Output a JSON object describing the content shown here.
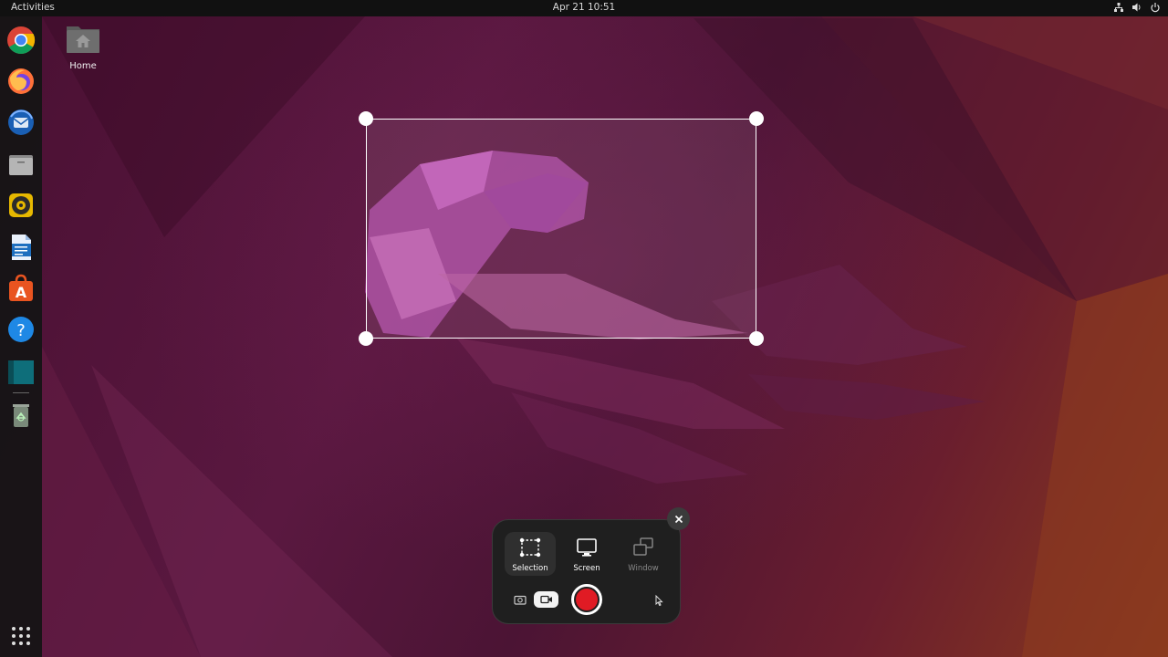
{
  "topbar": {
    "activities_label": "Activities",
    "datetime": "Apr 21  10:51",
    "tray_icons": [
      "network-icon",
      "volume-icon",
      "power-icon"
    ]
  },
  "dock": {
    "apps": [
      {
        "name": "chrome-icon",
        "color": "#4285f4"
      },
      {
        "name": "firefox-icon",
        "color": "#ff7139"
      },
      {
        "name": "thunderbird-icon",
        "color": "#2a7ad2"
      },
      {
        "name": "files-icon",
        "color": "#9b9b9b"
      },
      {
        "name": "rhythmbox-icon",
        "color": "#e6b800"
      },
      {
        "name": "writer-icon",
        "color": "#1e6fbf"
      },
      {
        "name": "software-icon",
        "color": "#e95420"
      },
      {
        "name": "help-icon",
        "color": "#1e88e5"
      },
      {
        "name": "terminal-icon",
        "color": "#0e6e7a"
      },
      {
        "name": "trash-icon",
        "color": "#7a8a7a"
      }
    ],
    "show_apps_icon": "app-grid-icon"
  },
  "desktop": {
    "home_label": "Home"
  },
  "screenshot_ui": {
    "modes": [
      {
        "label": "Selection",
        "active": true
      },
      {
        "label": "Screen",
        "active": false
      },
      {
        "label": "Window",
        "active": false
      }
    ],
    "capture_type": "video",
    "record_color": "#e01b24"
  }
}
